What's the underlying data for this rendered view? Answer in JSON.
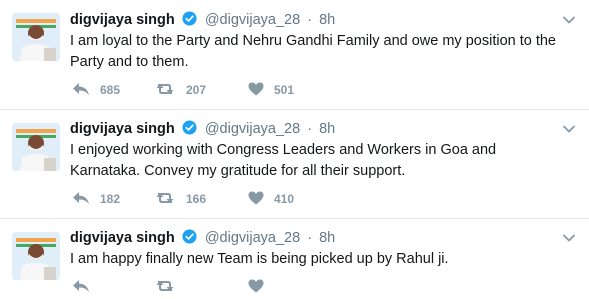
{
  "tweets": [
    {
      "name": "digvijaya singh",
      "handle": "@digvijaya_28",
      "separator": "·",
      "time": "8h",
      "text": "I am loyal to the Party and Nehru Gandhi Family and owe my position to the Party and to them.",
      "replies": "685",
      "retweets": "207",
      "likes": "501"
    },
    {
      "name": "digvijaya singh",
      "handle": "@digvijaya_28",
      "separator": "·",
      "time": "8h",
      "text": "I enjoyed working with Congress Leaders and Workers in Goa and Karnataka. Convey my gratitude for all their support.",
      "replies": "182",
      "retweets": "166",
      "likes": "410"
    },
    {
      "name": "digvijaya singh",
      "handle": "@digvijaya_28",
      "separator": "·",
      "time": "8h",
      "text": "I am happy finally new Team is being picked up by Rahul ji."
    }
  ],
  "colors": {
    "verified_badge": "#1da1f2",
    "meta_text": "#657786",
    "action_icon": "#8899a6",
    "divider": "#e6ecf0",
    "avatar_flag_saffron": "#f29b38",
    "avatar_flag_green": "#2f9a44"
  },
  "icons": [
    "reply-icon",
    "retweet-icon",
    "like-icon",
    "caret-down-icon",
    "verified-badge-icon"
  ]
}
